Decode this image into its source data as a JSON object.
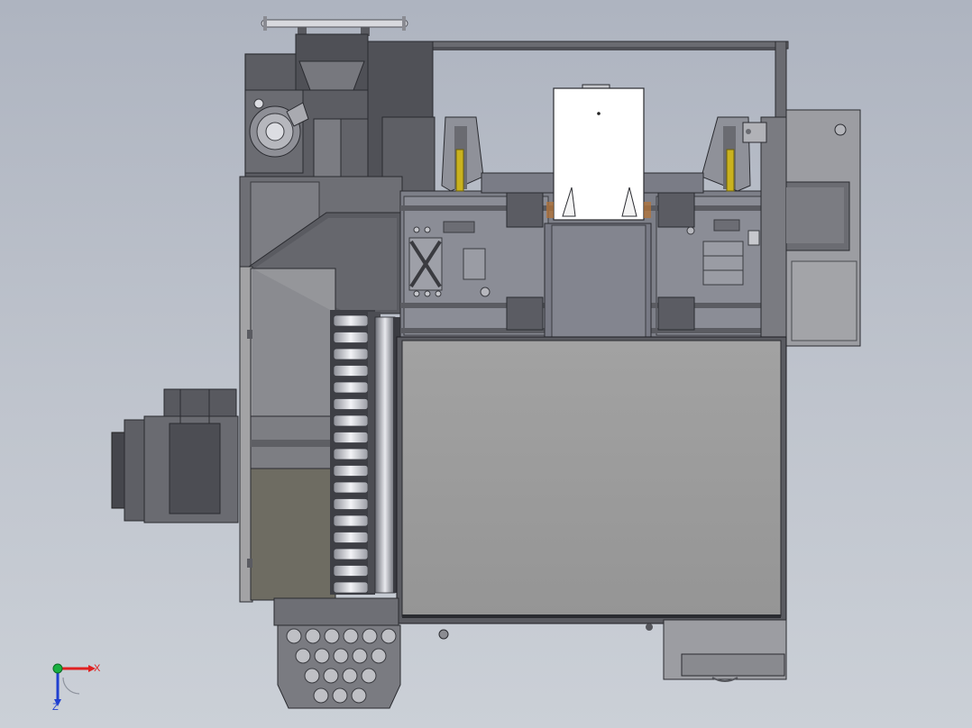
{
  "view": {
    "type": "cad-3d-viewport",
    "projection": "top",
    "background": "#b8bdc7"
  },
  "triad": {
    "x_label": "X",
    "z_label": "Z",
    "colors": {
      "x": "#e02020",
      "y": "#18b040",
      "z": "#2040d0"
    }
  },
  "model": {
    "palette": {
      "frame": "#7e8088",
      "dark": "#4a4b50",
      "mid": "#6d6e74",
      "light": "#a7a7aa",
      "panel": "#9b9b9b",
      "yellow": "#c9b21e",
      "white": "#ffffff",
      "copper": "#b87333"
    }
  }
}
